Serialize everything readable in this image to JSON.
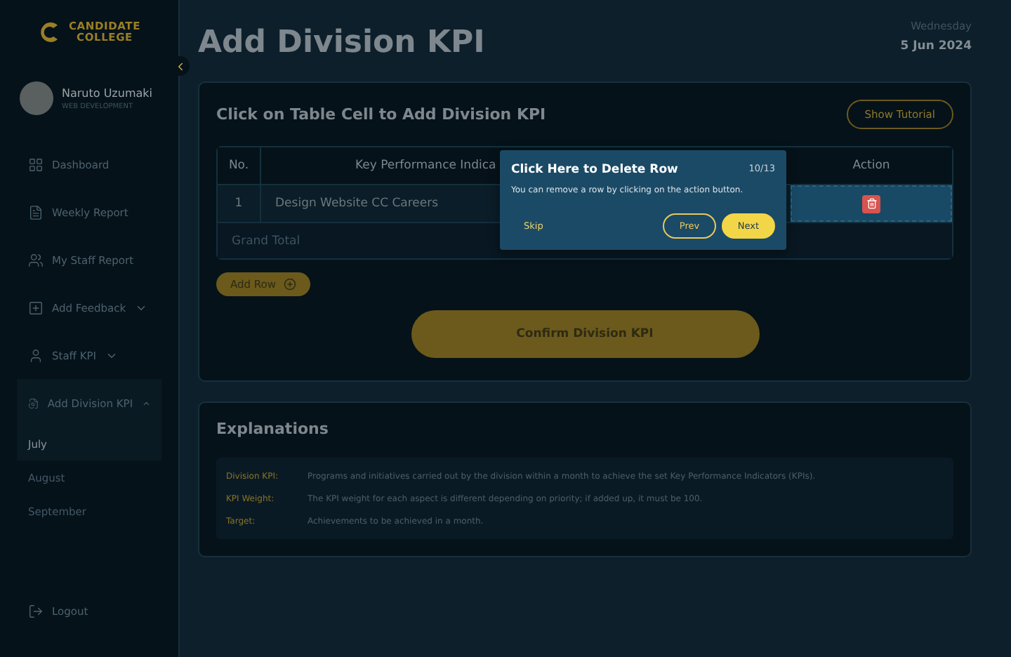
{
  "logo": {
    "line1": "CANDIDATE",
    "line2": "COLLEGE"
  },
  "user": {
    "name": "Naruto Uzumaki",
    "role": "WEB DEVELOPMENT"
  },
  "nav": [
    {
      "label": "Dashboard"
    },
    {
      "label": "Weekly Report"
    },
    {
      "label": "My Staff Report"
    },
    {
      "label": "Add Feedback",
      "expanded": false
    },
    {
      "label": "Staff KPI",
      "expanded": false
    },
    {
      "label": "Add Division KPI",
      "expanded": true,
      "children": [
        {
          "label": "July",
          "selected": true
        },
        {
          "label": "August",
          "selected": false
        },
        {
          "label": "September",
          "selected": false
        }
      ]
    }
  ],
  "logout": "Logout",
  "page": {
    "title": "Add Division KPI",
    "day": "Wednesday",
    "date": "5 Jun 2024"
  },
  "kpi_card": {
    "title": "Click on Table Cell to Add Division KPI",
    "tutorial_button": "Show Tutorial",
    "columns": [
      "No.",
      "Key Performance Indica"
    ],
    "action_column": "Action",
    "rows": [
      {
        "no": "1",
        "kpi": "Design Website CC Careers"
      }
    ],
    "total_label": "Grand Total",
    "add_row": "Add Row",
    "confirm": "Confirm Division KPI"
  },
  "tour": {
    "title": "Click Here to Delete Row",
    "step": "10/13",
    "text": "You can remove a row by clicking on the action button.",
    "skip": "Skip",
    "prev": "Prev",
    "next": "Next"
  },
  "explanations": {
    "title": "Explanations",
    "items": [
      {
        "term": "Division KPI:",
        "text": "Programs and initiatives carried out by the division within a month to achieve the set Key Performance Indicators (KPIs)."
      },
      {
        "term": "KPI Weight:",
        "text": "The KPI weight for each aspect is different depending on priority; if added up, it must be 100."
      },
      {
        "term": "Target:",
        "text": "Achievements to be achieved in a month."
      }
    ]
  }
}
